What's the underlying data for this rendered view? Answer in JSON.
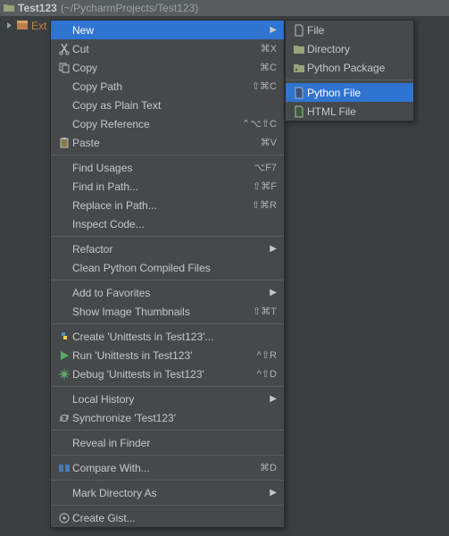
{
  "title": {
    "name": "Test123",
    "path": "(~/PycharmProjects/Test123)"
  },
  "project_row": {
    "label": "Ext"
  },
  "menu": [
    {
      "label": "New",
      "highlight": true,
      "submenu": true
    },
    {
      "icon": "cut-icon",
      "label": "Cut",
      "shortcut": "⌘X"
    },
    {
      "icon": "copy-icon",
      "label": "Copy",
      "shortcut": "⌘C"
    },
    {
      "label": "Copy Path",
      "shortcut": "⇧⌘C"
    },
    {
      "label": "Copy as Plain Text"
    },
    {
      "label": "Copy Reference",
      "shortcut": "⌃⌥⇧C"
    },
    {
      "icon": "paste-icon",
      "label": "Paste",
      "shortcut": "⌘V"
    },
    {
      "sep": true
    },
    {
      "label": "Find Usages",
      "shortcut": "⌥F7"
    },
    {
      "label": "Find in Path...",
      "shortcut": "⇧⌘F"
    },
    {
      "label": "Replace in Path...",
      "shortcut": "⇧⌘R"
    },
    {
      "label": "Inspect Code..."
    },
    {
      "sep": true
    },
    {
      "label": "Refactor",
      "submenu": true
    },
    {
      "label": "Clean Python Compiled Files"
    },
    {
      "sep": true
    },
    {
      "label": "Add to Favorites",
      "submenu": true
    },
    {
      "label": "Show Image Thumbnails",
      "shortcut": "⇧⌘T"
    },
    {
      "sep": true
    },
    {
      "icon": "python-icon",
      "label": "Create 'Unittests in Test123'..."
    },
    {
      "icon": "run-icon",
      "label": "Run 'Unittests in Test123'",
      "shortcut": "^⇧R"
    },
    {
      "icon": "debug-icon",
      "label": "Debug 'Unittests in Test123'",
      "shortcut": "^⇧D"
    },
    {
      "sep": true
    },
    {
      "label": "Local History",
      "submenu": true
    },
    {
      "icon": "sync-icon",
      "label": "Synchronize 'Test123'"
    },
    {
      "sep": true
    },
    {
      "label": "Reveal in Finder"
    },
    {
      "sep": true
    },
    {
      "icon": "compare-icon",
      "label": "Compare With...",
      "shortcut": "⌘D"
    },
    {
      "sep": true
    },
    {
      "label": "Mark Directory As",
      "submenu": true
    },
    {
      "sep": true
    },
    {
      "icon": "gist-icon",
      "label": "Create Gist..."
    }
  ],
  "submenu": [
    {
      "icon": "file-icon",
      "label": "File"
    },
    {
      "icon": "folder-icon",
      "label": "Directory"
    },
    {
      "icon": "package-icon",
      "label": "Python Package"
    },
    {
      "sep": true
    },
    {
      "icon": "pyfile-icon",
      "label": "Python File",
      "highlight": true
    },
    {
      "icon": "htmlfile-icon",
      "label": "HTML File"
    }
  ]
}
